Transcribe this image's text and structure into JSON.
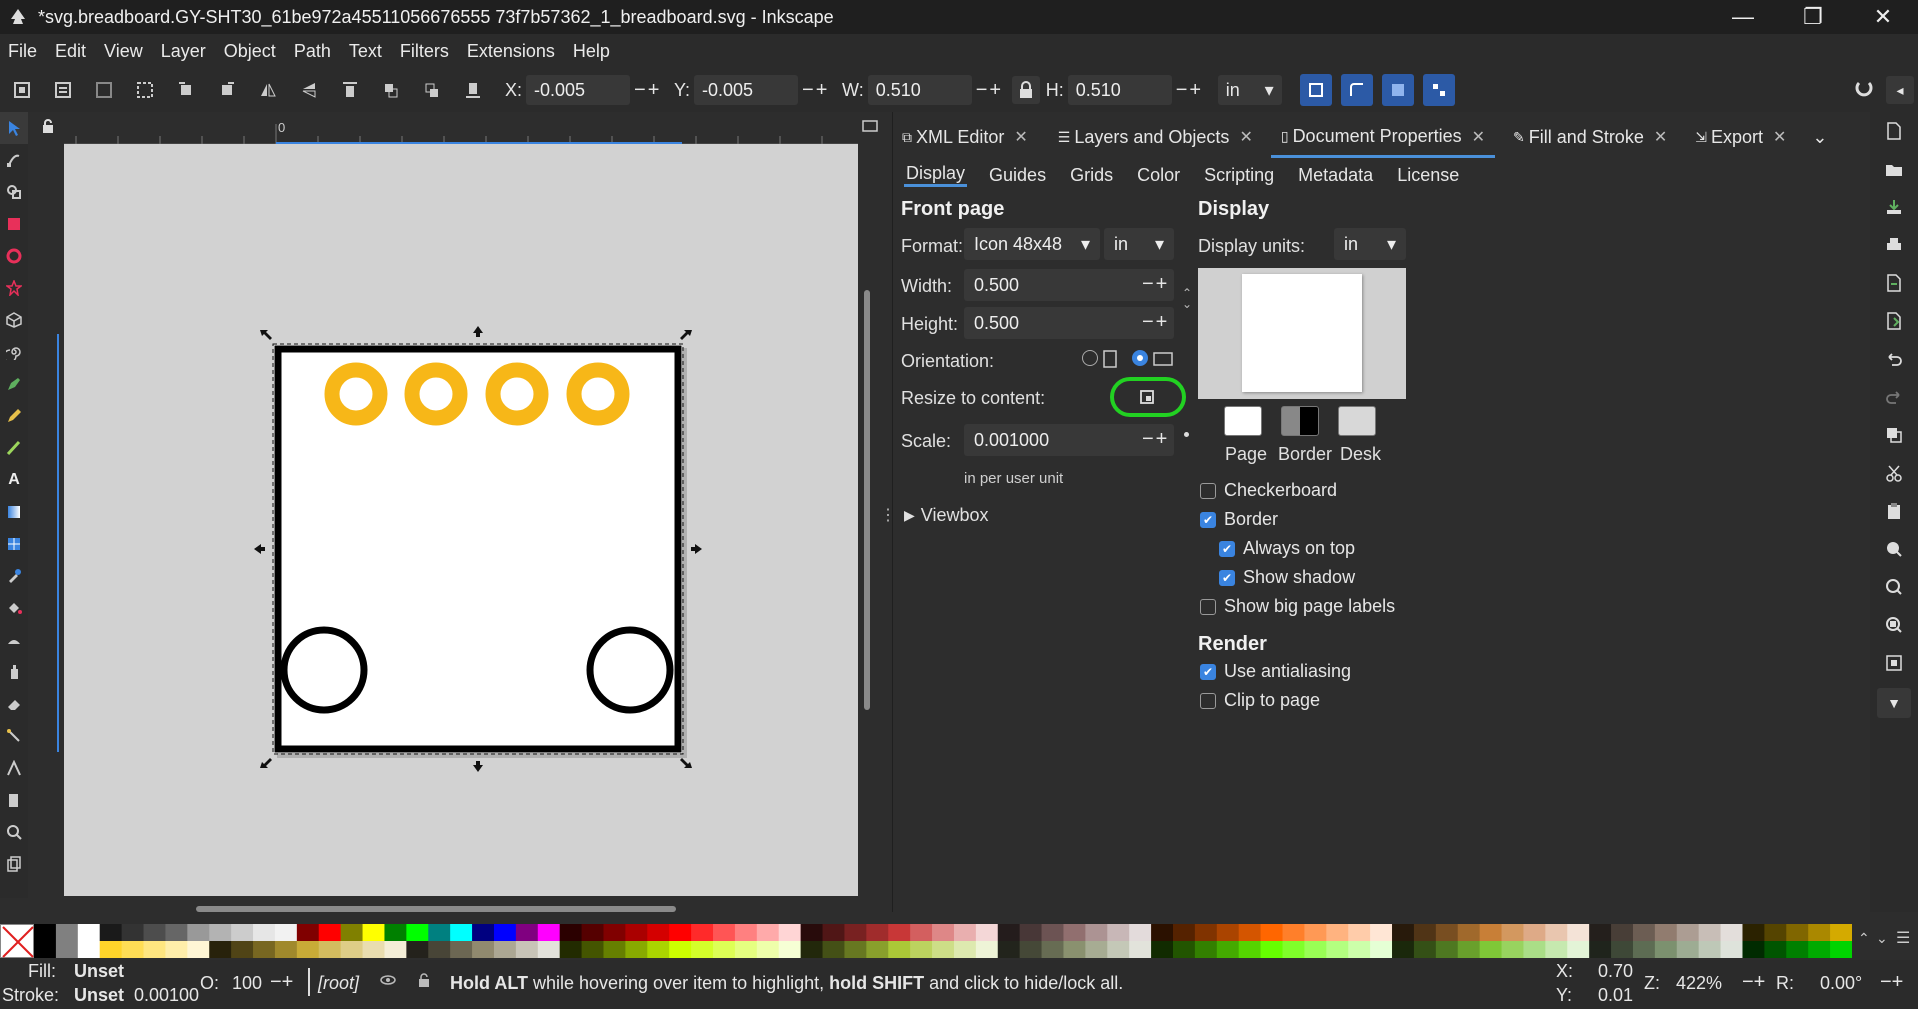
{
  "window": {
    "title": "*svg.breadboard.GY-SHT30_61be972a45511056676555 73f7b57362_1_breadboard.svg - Inkscape",
    "min_glyph": "—",
    "max_glyph": "❐",
    "close_glyph": "✕"
  },
  "menu": [
    "File",
    "Edit",
    "View",
    "Layer",
    "Object",
    "Path",
    "Text",
    "Filters",
    "Extensions",
    "Help"
  ],
  "toolbar": {
    "x_label": "X:",
    "x_value": "-0.005",
    "y_label": "Y:",
    "y_value": "-0.005",
    "w_label": "W:",
    "w_value": "0.510",
    "h_label": "H:",
    "h_value": "0.510",
    "pm": "−+",
    "unit": "in"
  },
  "ruler": {
    "zero_label": "0"
  },
  "dock": {
    "tabs": [
      {
        "label": "XML Editor"
      },
      {
        "label": "Layers and Objects"
      },
      {
        "label": "Document Properties"
      },
      {
        "label": "Fill and Stroke"
      },
      {
        "label": "Export"
      }
    ],
    "subtabs": [
      "Display",
      "Guides",
      "Grids",
      "Color",
      "Scripting",
      "Metadata",
      "License"
    ],
    "front_page": {
      "heading": "Front page",
      "format_label": "Format:",
      "format_value": "Icon 48x48",
      "format_unit": "in",
      "width_label": "Width:",
      "width_value": "0.500",
      "height_label": "Height:",
      "height_value": "0.500",
      "orientation_label": "Orientation:",
      "resize_label": "Resize to content:",
      "scale_label": "Scale:",
      "scale_value": "0.001000",
      "scale_hint": "in per user unit",
      "viewbox_label": "Viewbox",
      "pm": "−+"
    },
    "display": {
      "heading": "Display",
      "units_label": "Display units:",
      "units_value": "in",
      "swatch_labels": [
        "Page",
        "Border",
        "Desk"
      ],
      "checks": [
        {
          "label": "Checkerboard",
          "checked": false
        },
        {
          "label": "Border",
          "checked": true
        },
        {
          "label": "Always on top",
          "checked": true
        },
        {
          "label": "Show shadow",
          "checked": true
        },
        {
          "label": "Show big page labels",
          "checked": false
        }
      ]
    },
    "render": {
      "heading": "Render",
      "checks": [
        {
          "label": "Use antialiasing",
          "checked": true
        },
        {
          "label": "Clip to page",
          "checked": false
        }
      ]
    }
  },
  "status": {
    "fill_label": "Fill:",
    "fill_value": "Unset",
    "stroke_label": "Stroke:",
    "stroke_value": "Unset",
    "stroke_width": "0.00100",
    "opacity_label": "O:",
    "opacity_value": "100",
    "layer": "[root]",
    "message_pre": "Hold ALT",
    "message_mid": " while hovering over item to highlight, ",
    "message_bold2": "hold SHIFT",
    "message_post": " and click to hide/lock all.",
    "x_label": "X:",
    "x_value": "0.70",
    "y_label": "Y:",
    "y_value": "0.01",
    "zoom_label": "Z:",
    "zoom_value": "422%",
    "rot_label": "R:",
    "rot_value": "0.00°",
    "pm": "−+"
  },
  "colors": {
    "accent": "#3a84e0",
    "pad_yellow": "#f7b718",
    "highlight_green": "#22d122",
    "palette_row1": [
      "#000000",
      "#808080",
      "#ffffff",
      "#1a1a1a",
      "#333333",
      "#4d4d4d",
      "#666666",
      "#999999",
      "#b3b3b3",
      "#cccccc",
      "#e6e6e6",
      "#f2f2f2",
      "#800000",
      "#ff0000",
      "#808000",
      "#ffff00",
      "#008000",
      "#00ff00",
      "#008080",
      "#00ffff",
      "#000080",
      "#0000ff",
      "#800080",
      "#ff00ff",
      "#2b0000",
      "#550000",
      "#800000",
      "#aa0000",
      "#d40000",
      "#ff0000",
      "#ff2a2a",
      "#ff5555",
      "#ff8080",
      "#ffaaaa",
      "#ffd5d5",
      "#280b0b",
      "#501616",
      "#782121",
      "#a02c2c",
      "#c83737",
      "#d35f5f",
      "#de8787",
      "#e9afaf",
      "#f4d7d7",
      "#241c1c",
      "#483737",
      "#6c5353",
      "#916f6f",
      "#ac9393",
      "#c8b7b7",
      "#e3dbdb",
      "#2b1100",
      "#552200",
      "#803300",
      "#aa4400",
      "#d45500",
      "#ff6600",
      "#ff7f2a",
      "#ff9955",
      "#ffb380",
      "#ffccaa",
      "#ffe6d5",
      "#281a0b",
      "#503416",
      "#784e21",
      "#a0692c",
      "#c87f37",
      "#d3985f",
      "#deaa87",
      "#e9c6af",
      "#f4e3d7",
      "#241f1c",
      "#483e37",
      "#6c5d53",
      "#917c6f",
      "#ac9d93",
      "#c8beb7",
      "#e3dedb",
      "#2b2200",
      "#554400",
      "#806600",
      "#aa8800",
      "#d4aa00"
    ],
    "palette_row2": [
      "#c8a000",
      "#e0b800",
      "#f0c800",
      "#ffd42a",
      "#ffdd55",
      "#ffe680",
      "#ffeeaa",
      "#fff6d5",
      "#28220b",
      "#504416",
      "#786721",
      "#a0892c",
      "#c8ab37",
      "#d3bc5f",
      "#decd87",
      "#e9ddaf",
      "#f4eed7",
      "#24221c",
      "#484537",
      "#6c6753",
      "#918a6f",
      "#aca793",
      "#c8c4b7",
      "#e3e2db",
      "#222b00",
      "#445500",
      "#668000",
      "#88aa00",
      "#aad400",
      "#ccff00",
      "#d4ff2a",
      "#ddff55",
      "#e5ff80",
      "#eeffaa",
      "#f6ffd5",
      "#22280b",
      "#445016",
      "#677821",
      "#89a02c",
      "#abc837",
      "#bcd35f",
      "#cdde87",
      "#dde9af",
      "#eef4d7",
      "#22241c",
      "#454837",
      "#676c53",
      "#8a916f",
      "#a7ac93",
      "#c4c8b7",
      "#e2e3db",
      "#112b00",
      "#225500",
      "#338000",
      "#44aa00",
      "#55d400",
      "#66ff00",
      "#7fff2a",
      "#99ff55",
      "#b3ff80",
      "#ccffaa",
      "#e5ffd5",
      "#1a280b",
      "#345016",
      "#4e7821",
      "#69a02c",
      "#7fc837",
      "#98d35f",
      "#aade87",
      "#c6e9af",
      "#e3f4d7",
      "#1f241c",
      "#3e4837",
      "#5d6c53",
      "#7c916f",
      "#9dac93",
      "#bec8b7",
      "#dee3db",
      "#002b00",
      "#005500",
      "#008000",
      "#00aa00",
      "#00d400"
    ]
  }
}
